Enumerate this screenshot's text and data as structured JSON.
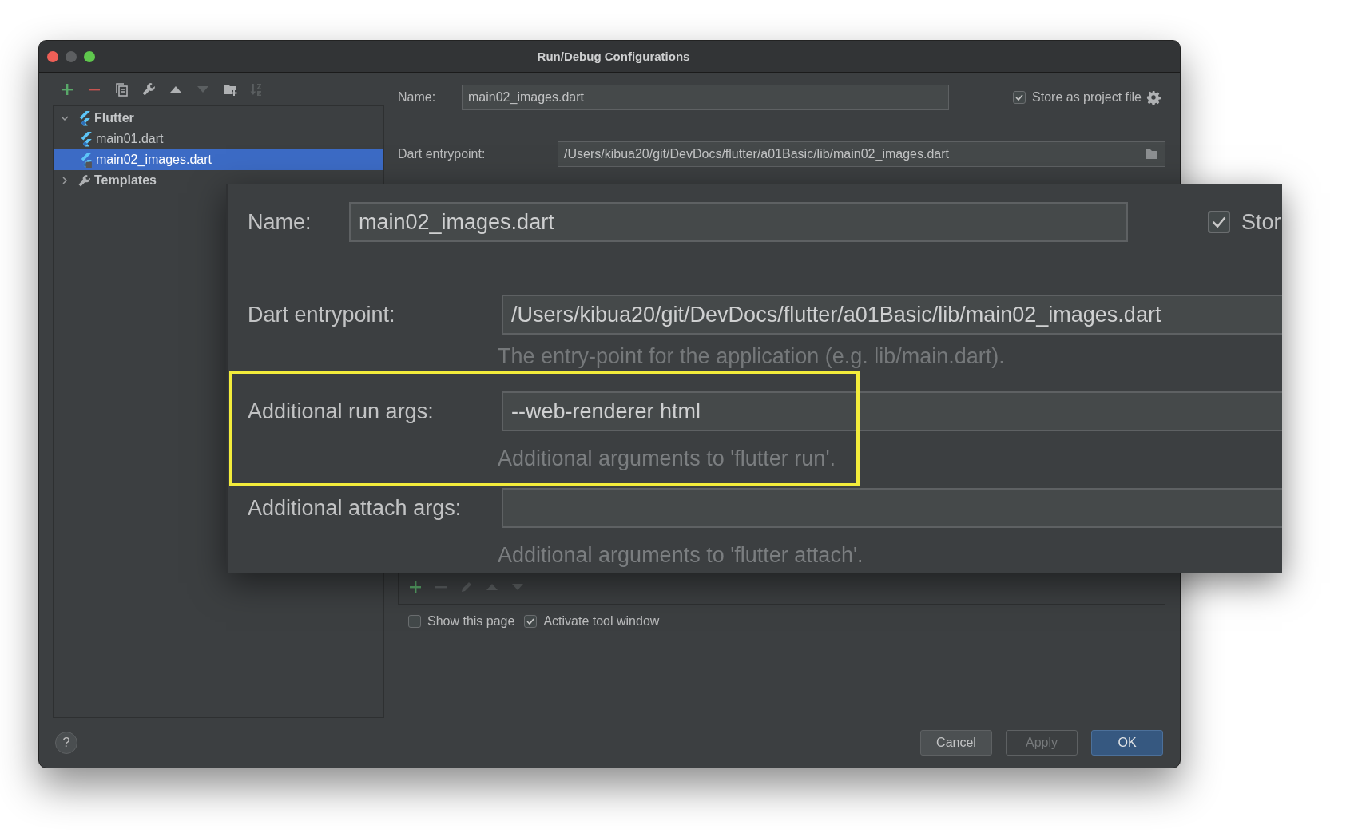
{
  "window": {
    "title": "Run/Debug Configurations"
  },
  "toolbar": [
    {
      "kind": "add",
      "disabled": false
    },
    {
      "kind": "remove",
      "disabled": false
    },
    {
      "kind": "copy",
      "disabled": false
    },
    {
      "kind": "wrench",
      "disabled": false
    },
    {
      "kind": "up",
      "disabled": false
    },
    {
      "kind": "down",
      "disabled": true
    },
    {
      "kind": "folder",
      "disabled": false
    },
    {
      "kind": "sort",
      "disabled": true
    }
  ],
  "tree": [
    {
      "label": "Flutter",
      "kind": "flutter",
      "expanded": true,
      "selected": false,
      "children": [
        {
          "label": "main01.dart",
          "kind": "flutter",
          "selected": false
        },
        {
          "label": "main02_images.dart",
          "kind": "flutter-shared",
          "selected": true
        }
      ]
    },
    {
      "label": "Templates",
      "kind": "wrench",
      "expanded": false,
      "selected": false
    }
  ],
  "form": {
    "name_label": "Name:",
    "name_value": "main02_images.dart",
    "store_label": "Store as project file",
    "store_checked": true,
    "entrypoint_label": "Dart entrypoint:",
    "entrypoint_value": "/Users/kibua20/git/DevDocs/flutter/a01Basic/lib/main02_images.dart"
  },
  "before_launch_toolbar": [
    {
      "kind": "add",
      "disabled": false
    },
    {
      "kind": "remove",
      "disabled": true
    },
    {
      "kind": "edit",
      "disabled": true
    },
    {
      "kind": "up",
      "disabled": true
    },
    {
      "kind": "down",
      "disabled": true
    }
  ],
  "options": [
    {
      "label": "Show this page",
      "checked": false
    },
    {
      "label": "Activate tool window",
      "checked": true
    }
  ],
  "help": "?",
  "buttons": [
    {
      "label": "Cancel",
      "kind": "normal",
      "disabled": false
    },
    {
      "label": "Apply",
      "kind": "normal",
      "disabled": true
    },
    {
      "label": "OK",
      "kind": "default",
      "disabled": false
    }
  ],
  "zoom_inset": {
    "name_label": "Name:",
    "name_value": "main02_images.dart",
    "store_label": "Stor",
    "store_checked": true,
    "fields": [
      {
        "label": "Dart entrypoint:",
        "value": "/Users/kibua20/git/DevDocs/flutter/a01Basic/lib/main02_images.dart",
        "hint": "The entry-point for the application (e.g. lib/main.dart).",
        "highlighted": false
      },
      {
        "label": "Additional run args:",
        "value": "--web-renderer html",
        "hint": "Additional arguments to 'flutter run'.",
        "highlighted": true
      },
      {
        "label": "Additional attach args:",
        "hint": "Additional arguments to 'flutter attach'.",
        "highlighted": false
      }
    ]
  }
}
